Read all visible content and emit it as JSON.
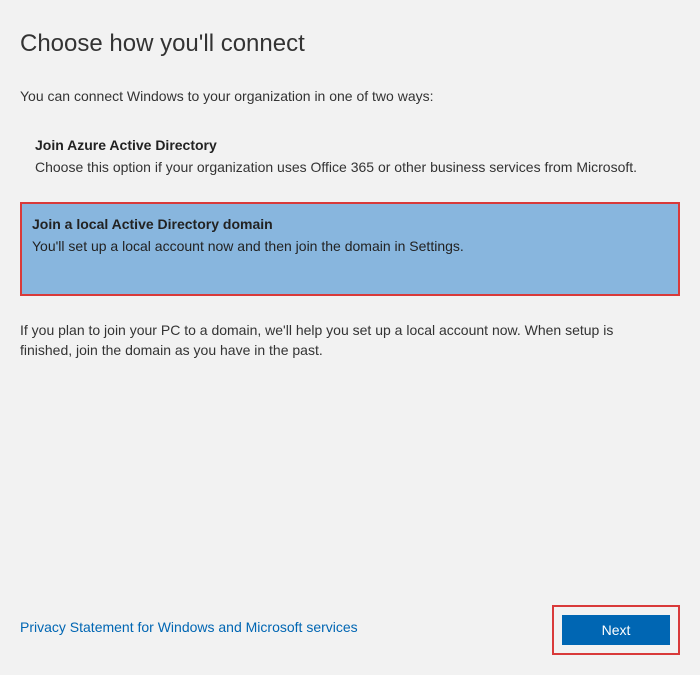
{
  "title": "Choose how you'll connect",
  "intro": "You can connect Windows to your organization in one of two ways:",
  "options": [
    {
      "title": "Join Azure Active Directory",
      "desc": "Choose this option if your organization uses Office 365 or other business services from Microsoft.",
      "selected": false
    },
    {
      "title": "Join a local Active Directory domain",
      "desc": "You'll set up a local account now and then join the domain in Settings.",
      "selected": true
    }
  ],
  "below": "If you plan to join your PC to a domain, we'll help you set up a local account now. When setup is finished, join the domain as you have in the past.",
  "privacy": "Privacy Statement for Windows and Microsoft services",
  "next": "Next"
}
